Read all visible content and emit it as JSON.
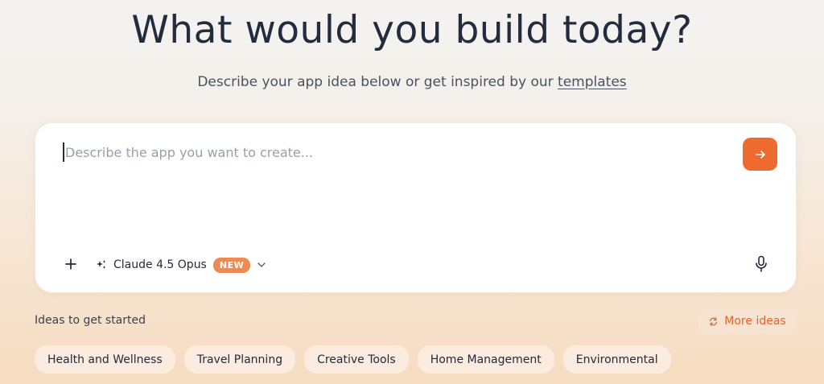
{
  "hero": {
    "title": "What would you build today?",
    "subtitle_prefix": "Describe your app idea below or get inspired by our",
    "subtitle_link": "templates"
  },
  "composer": {
    "placeholder": "Describe the app you want to create...",
    "value": "",
    "send_icon": "arrow-right-icon",
    "add_icon": "plus-icon",
    "model": {
      "icon": "sparkle-icon",
      "label": "Claude 4.5 Opus",
      "badge": "NEW",
      "dropdown_icon": "chevron-down-icon"
    },
    "mic_icon": "microphone-icon"
  },
  "ideas": {
    "label": "Ideas to get started",
    "more_label": "More ideas",
    "more_icon": "refresh-icon",
    "chips": [
      "Health and Wellness",
      "Travel Planning",
      "Creative Tools",
      "Home Management",
      "Environmental"
    ]
  },
  "colors": {
    "accent": "#ef6a2f",
    "badge": "#f08a54",
    "chip_bg": "#fbecdf",
    "title": "#232c3e"
  }
}
